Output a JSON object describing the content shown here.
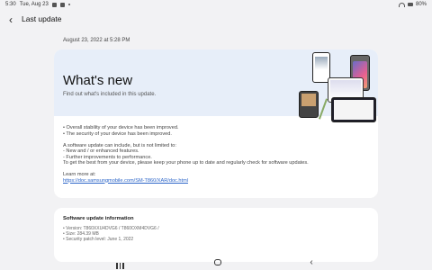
{
  "status_bar": {
    "time": "5:30",
    "date": "Tue, Aug 23",
    "battery": "80%"
  },
  "app_bar": {
    "back_label": "‹",
    "title": "Last update"
  },
  "update_date": "August 23, 2022 at 5:28 PM",
  "hero": {
    "title": "What's new",
    "subtitle": "Find out what's included in this update."
  },
  "notes": {
    "line1": "• Overall stability of your device has been improved.",
    "line2": "• The security of your device has been improved.",
    "line3": "A software update can include, but is not limited to:",
    "line4": "- New and / or enhanced features.",
    "line5": "- Further improvements to performance.",
    "line6": "To get the best from your device, please keep your phone up to date and regularly check for software updates.",
    "learn_more": "Learn more at:",
    "link": "https://doc.samsungmobile.com/SM-T860/XAR/doc.html"
  },
  "info": {
    "title": "Software update information",
    "version": "• Version: T860XXU4DVG6 / T860OXM4DVG6 /",
    "size": "• Size: 284.39 MB",
    "patch": "• Security patch level: June 1, 2022"
  },
  "nav": {
    "back_label": "‹"
  }
}
